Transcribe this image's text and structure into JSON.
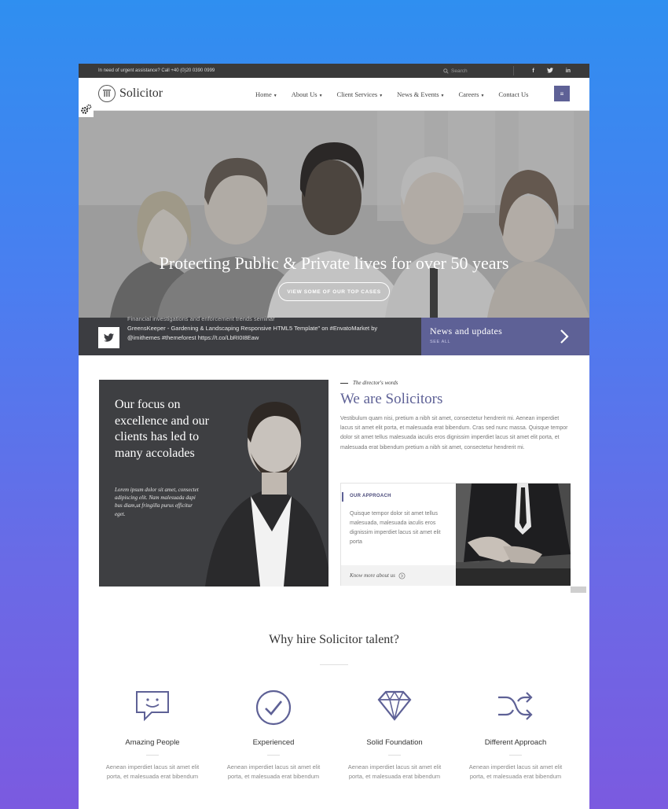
{
  "topbar": {
    "urgent": "In need of urgent assistance? Call +40 (0)20 0390 0999",
    "search_placeholder": "Search",
    "social": [
      "f",
      "t",
      "in"
    ]
  },
  "brand": {
    "name": "Solicitor"
  },
  "nav": {
    "items": [
      "Home",
      "About Us",
      "Client Services",
      "News & Events",
      "Careers",
      "Contact Us"
    ],
    "has_caret": [
      true,
      true,
      true,
      true,
      true,
      false
    ],
    "menu_icon": "≡"
  },
  "hero": {
    "title": "Protecting Public & Private lives for over 50 years",
    "button": "VIEW SOME OF OUR TOP CASES"
  },
  "tweet": {
    "cut_line": "Financial investigations and enforcement trends seminar",
    "line1": "GreensKeeper - Gardening & Landscaping Responsive HTML5 Template\" on #EnvatoMarket by",
    "line2": "@imithemes #themeforest https://t.co/LbRI0I8Eaw"
  },
  "news": {
    "title": "News and updates",
    "see_all": "SEE ALL"
  },
  "focus": {
    "title": "Our focus on excellence and our clients has led to many accolades",
    "sub": "Lorem ipsum dolor sit amet, consectet adipiscing elit. Nam malesuada dapi bus diam,ut fringilla purus efficitur eget."
  },
  "director": {
    "kicker": "The director's words",
    "heading": "We are Solicitors",
    "paragraph": "Vestibulum quam nisi, pretium a nibh sit amet, consectetur hendrerit mi. Aenean imperdiet lacus sit amet elit porta, et malesuada erat bibendum. Cras sed nunc massa. Quisque tempor dolor sit amet tellus malesuada iaculis eros dignissim imperdiet lacus sit amet elit porta, et malesuada erat bibendum pretium a nibh sit amet, consectetur hendrerit mi."
  },
  "approach": {
    "title": "OUR APPROACH",
    "text": "Quisque tempor dolor sit amet tellus malesuada, malesuada iaculis eros dignissim imperdiet lacus sit amet elit porta",
    "link": "Know more about us"
  },
  "why": {
    "title": "Why hire Solicitor talent?",
    "features": [
      {
        "title": "Amazing People",
        "desc": "Aenean imperdiet lacus sit amet elit porta, et malesuada erat bibendum",
        "icon": "chat-smile-icon"
      },
      {
        "title": "Experienced",
        "desc": "Aenean imperdiet lacus sit amet elit porta, et malesuada erat bibendum",
        "icon": "check-circle-icon"
      },
      {
        "title": "Solid Foundation",
        "desc": "Aenean imperdiet lacus sit amet elit porta, et malesuada erat bibendum",
        "icon": "diamond-icon"
      },
      {
        "title": "Different Approach",
        "desc": "Aenean imperdiet lacus sit amet elit porta, et malesuada erat bibendum",
        "icon": "shuffle-icon"
      }
    ]
  },
  "colors": {
    "accent": "#5e6196",
    "topbar": "#3a3a3a",
    "dark_card": "#3e3f42"
  }
}
